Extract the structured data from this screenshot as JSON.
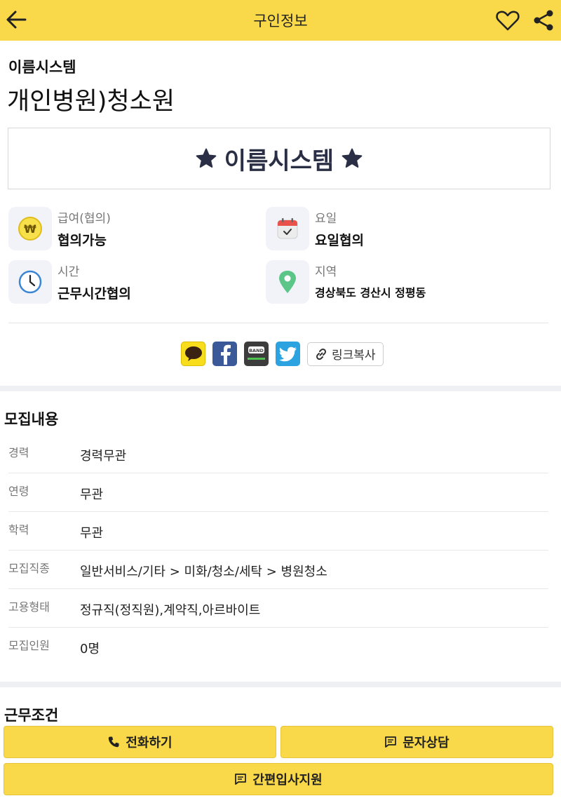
{
  "header": {
    "title": "구인정보"
  },
  "job": {
    "company": "이름시스템",
    "title": "개인병원)청소원"
  },
  "banner": {
    "text": "이름시스템"
  },
  "info": {
    "pay": {
      "label": "급여(협의)",
      "value": "협의가능"
    },
    "days": {
      "label": "요일",
      "value": "요일협의"
    },
    "time": {
      "label": "시간",
      "value": "근무시간협의"
    },
    "area": {
      "label": "지역",
      "value": "경상북도 경산시 정평동"
    }
  },
  "share": {
    "copy_link": "링크복사",
    "band_label": "BAND"
  },
  "recruit": {
    "title": "모집내용",
    "rows": [
      {
        "label": "경력",
        "value": "경력무관"
      },
      {
        "label": "연령",
        "value": "무관"
      },
      {
        "label": "학력",
        "value": "무관"
      },
      {
        "label": "모집직종",
        "value": "일반서비스/기타 > 미화/청소/세탁 > 병원청소"
      },
      {
        "label": "고용형태",
        "value": "정규직(정직원),계약직,아르바이트"
      },
      {
        "label": "모집인원",
        "value": "0명"
      }
    ]
  },
  "conditions": {
    "title": "근무조건"
  },
  "actions": {
    "call": "전화하기",
    "sms": "문자상담",
    "apply": "간편입사지원"
  },
  "colors": {
    "accent": "#f9d94a",
    "banner_text": "#2b2f45",
    "location_pin": "#5cc689",
    "clock": "#3a86d4"
  }
}
